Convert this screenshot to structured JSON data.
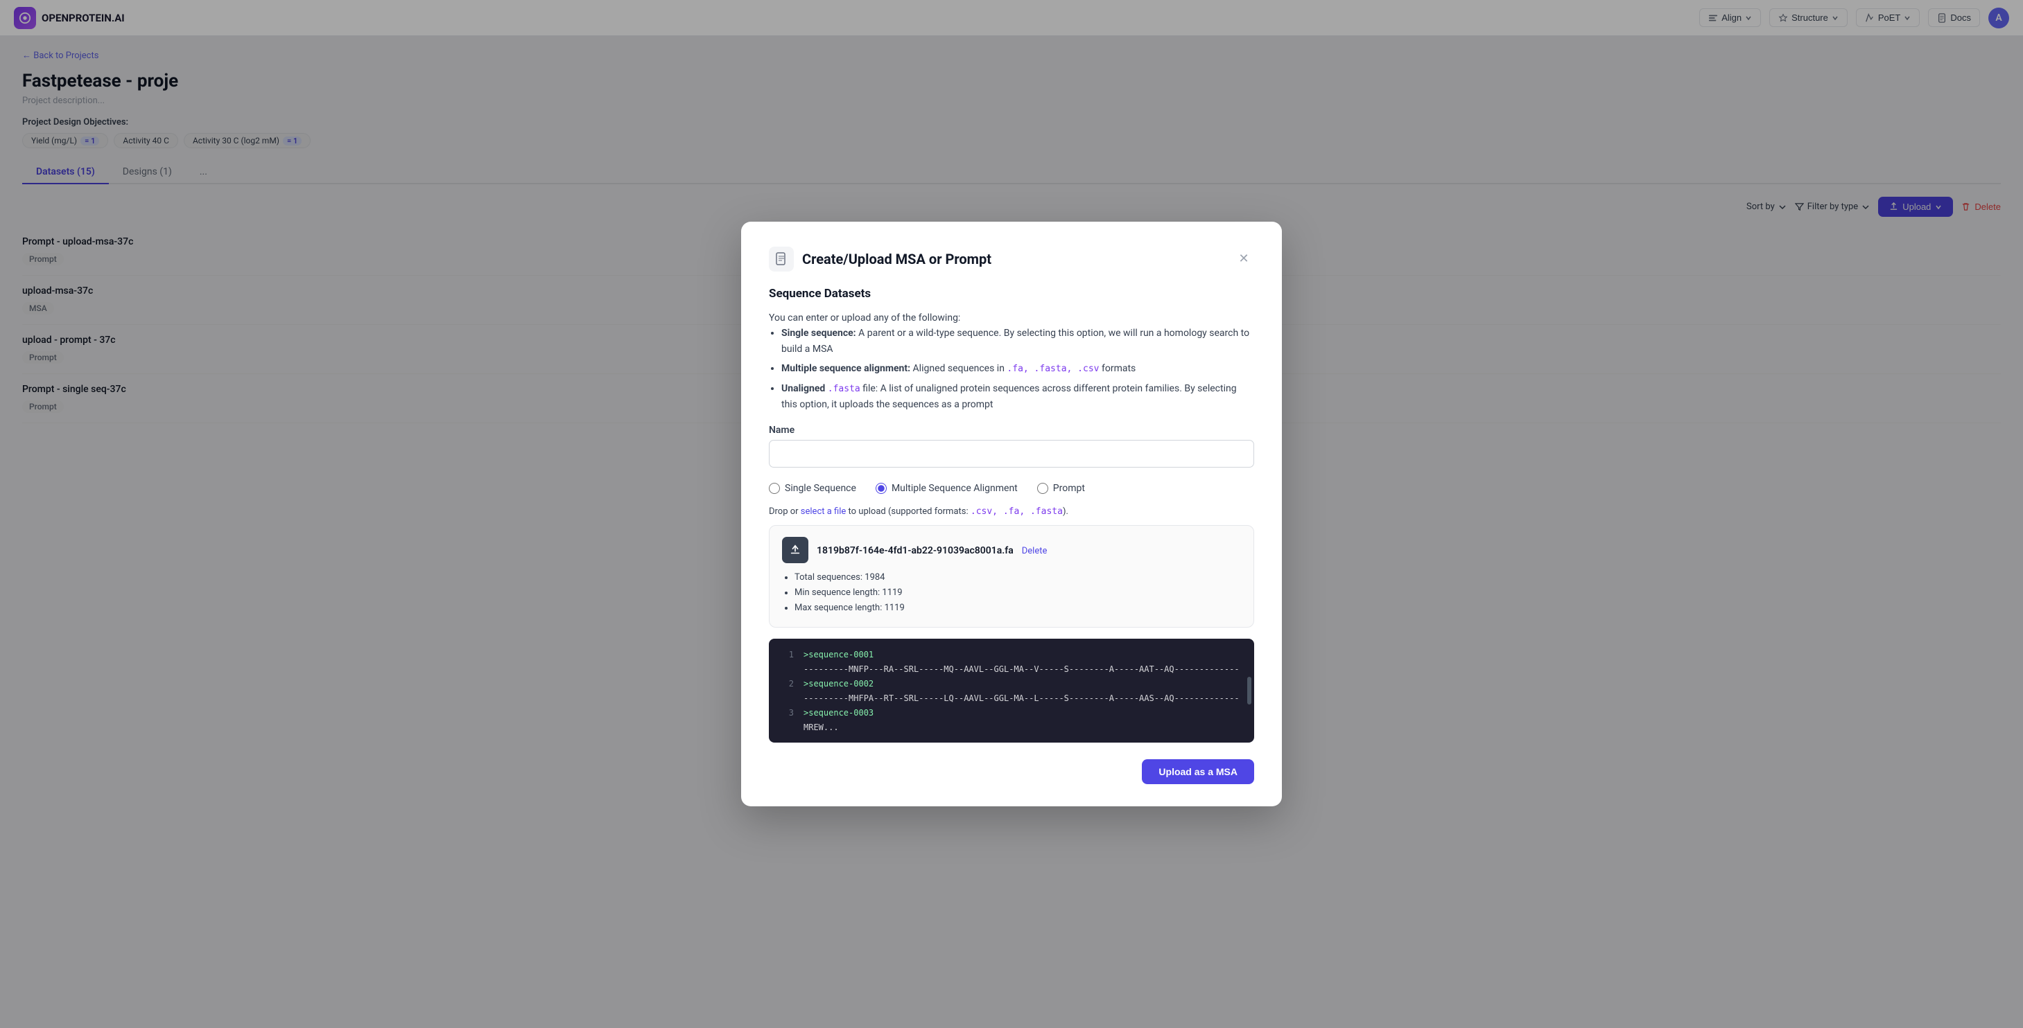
{
  "app": {
    "name": "OPENPROTEIN.AI",
    "logo_letter": "O"
  },
  "topnav": {
    "align_label": "Align",
    "structure_label": "Structure",
    "poet_label": "PoET",
    "docs_label": "Docs",
    "avatar_letter": "A"
  },
  "background": {
    "back_label": "← Back to Projects",
    "page_title": "Fastpetease - proje",
    "page_desc": "Project description...",
    "objectives_label": "Project Design Objectives:",
    "objectives": [
      {
        "name": "Yield (mg/L)",
        "count": "1"
      },
      {
        "name": "Activity 40 C",
        "count": ""
      },
      {
        "name": "Activity 30 C (log2 mM)",
        "count": "1"
      }
    ],
    "tabs": [
      {
        "label": "Datasets (15)",
        "active": true
      },
      {
        "label": "Designs (1)",
        "active": false
      },
      {
        "label": "...",
        "active": false
      }
    ],
    "toolbar": {
      "upload_label": "Upload",
      "delete_label": "Delete",
      "sortby_label": "Sort by",
      "filterby_label": "Filter by type"
    },
    "datasets": [
      {
        "name": "Prompt - upload-msa-37c",
        "badge": "Prompt",
        "badge_type": "prompt"
      },
      {
        "name": "upload-msa-37c",
        "badge": "MSA",
        "badge_type": "msa"
      },
      {
        "name": "upload - prompt - 37c",
        "badge": "Prompt",
        "badge_type": "prompt"
      },
      {
        "name": "Prompt - single seq-37c",
        "badge": "Prompt",
        "badge_type": "prompt"
      }
    ]
  },
  "modal": {
    "title": "Create/Upload MSA or Prompt",
    "section_title": "Sequence Datasets",
    "description_intro": "You can enter or upload any of the following:",
    "items": [
      {
        "bold": "Single sequence:",
        "text": "A parent or a wild-type sequence. By selecting this option, we will run a homology search to build a MSA"
      },
      {
        "bold": "Multiple sequence alignment:",
        "text": "Aligned sequences in ",
        "codes": [
          ".fa, .fasta, .csv"
        ],
        "text2": " formats"
      },
      {
        "bold": "Unaligned",
        "code_inline": ".fasta",
        "text": " file: A list of unaligned protein sequences across different protein families. By selecting this option, it uploads the sequences as a prompt"
      }
    ],
    "name_label": "Name",
    "name_placeholder": "",
    "radio_options": [
      {
        "label": "Single Sequence",
        "value": "single",
        "checked": false
      },
      {
        "label": "Multiple Sequence Alignment",
        "value": "msa",
        "checked": true
      },
      {
        "label": "Prompt",
        "value": "prompt",
        "checked": false
      }
    ],
    "drop_hint": "Drop or",
    "drop_link": "select a file",
    "drop_hint2": "to upload (supported formats:",
    "drop_formats": ".csv, .fa, .fasta",
    "drop_hint3": ").",
    "file": {
      "name": "1819b87f-164e-4fd1-ab22-91039ac8001a.fa",
      "delete_label": "Delete",
      "total_sequences": "Total sequences: 1984",
      "min_length": "Min sequence length: 1119",
      "max_length": "Max sequence length: 1119"
    },
    "sequences": [
      {
        "num": "1",
        "id": ">sequence-0001",
        "data": "---------MNFP---RA--SRL-----MQ--AAVL--GGL-MA--V-----S--------A-----AAT--AQ-------------"
      },
      {
        "num": "2",
        "id": ">sequence-0002",
        "data": "---------MHFPA--RT--SRL-----LQ--AAVL--GGL-MA--L-----S--------A-----AAS--AQ-------------"
      },
      {
        "num": "3",
        "id": ">sequence-0003",
        "data": "MREW..."
      }
    ],
    "upload_button_label": "Upload as a MSA"
  }
}
